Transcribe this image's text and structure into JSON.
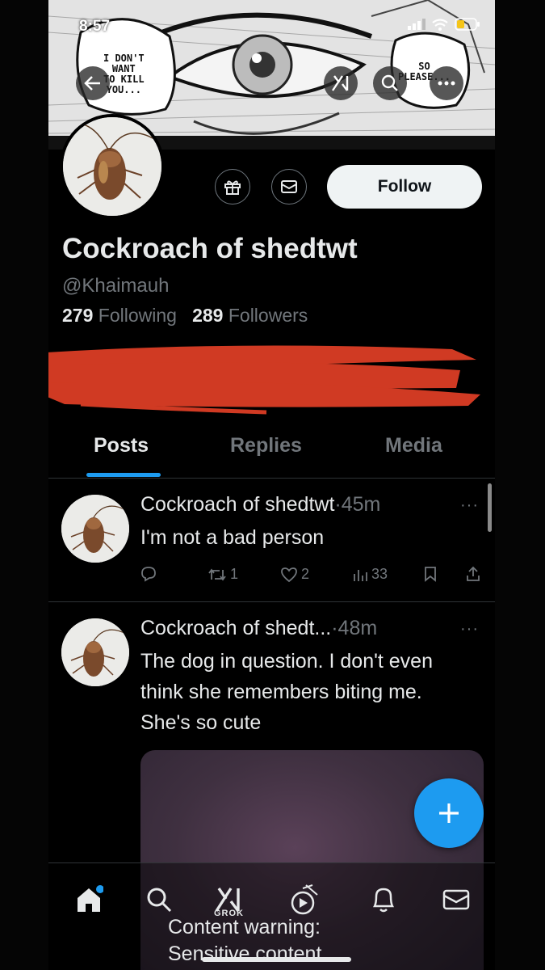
{
  "status_bar": {
    "time": "8:57"
  },
  "banner": {
    "bubble_left": [
      "I DON'T",
      "WANT",
      "TO KILL",
      "YOU..."
    ],
    "bubble_right": [
      "SO",
      "PLEASE..."
    ]
  },
  "profile": {
    "display_name": "Cockroach of shedtwt",
    "handle": "@Khaimauh",
    "following_count": "279",
    "following_label": "Following",
    "followers_count": "289",
    "followers_label": "Followers",
    "follow_label": "Follow"
  },
  "tabs": [
    {
      "label": "Posts"
    },
    {
      "label": "Replies"
    },
    {
      "label": "Media"
    }
  ],
  "posts": [
    {
      "name": "Cockroach of shedtwt",
      "time": "·45m",
      "text": "I'm not a bad person",
      "retweets": "1",
      "likes": "2",
      "views": "33"
    },
    {
      "name": "Cockroach of shedt...",
      "time": "·48m",
      "text": "The dog in question. I don't even think she remembers biting me. She's so cute"
    }
  ],
  "more_glyph": "···",
  "content_warning": {
    "title": "Content warning:",
    "subtitle": "Sensitive content"
  },
  "nav": {
    "grok_label": "GROK"
  },
  "colors": {
    "accent": "#1d9bf0",
    "redaction": "#d03a23",
    "background": "#000000"
  }
}
